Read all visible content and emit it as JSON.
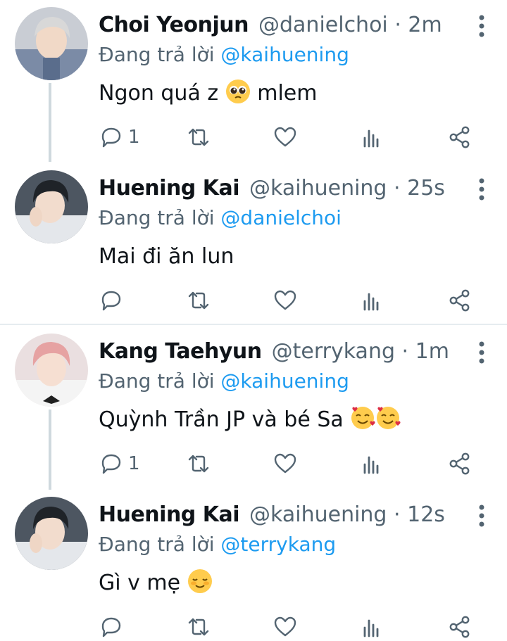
{
  "colors": {
    "text": "#0f1419",
    "secondary": "#536471",
    "link": "#1d9bf0",
    "thread": "#cfd9de"
  },
  "tweets": [
    {
      "name": "Choi Yeonjun",
      "handle": "@danielchoi",
      "separator": "·",
      "time": "2m",
      "reply_prefix": "Đang trả lời",
      "reply_to": "@kaihuening",
      "text": "Ngon quá z",
      "emoji": "pleading-face",
      "text_after": "mlem",
      "reply_count": "1",
      "avatar": "avatar-gray-hair"
    },
    {
      "name": "Huening Kai",
      "handle": "@kaihuening",
      "separator": "·",
      "time": "25s",
      "reply_prefix": "Đang trả lời",
      "reply_to": "@danielchoi",
      "text": "Mai đi ăn lun",
      "reply_count": "",
      "avatar": "avatar-dark-hair"
    },
    {
      "name": "Kang Taehyun",
      "handle": "@terrykang",
      "separator": "·",
      "time": "1m",
      "reply_prefix": "Đang trả lời",
      "reply_to": "@kaihuening",
      "text": "Quỳnh Trần JP và bé Sa",
      "emoji": "smiling-face-with-hearts",
      "reply_count": "1",
      "avatar": "avatar-pink-hair"
    },
    {
      "name": "Huening Kai",
      "handle": "@kaihuening",
      "separator": "·",
      "time": "12s",
      "reply_prefix": "Đang trả lời",
      "reply_to": "@terrykang",
      "text": "Gì v mẹ",
      "emoji": "smiling-face",
      "reply_count": "",
      "avatar": "avatar-dark-hair"
    }
  ],
  "action_icons": [
    "reply-icon",
    "retweet-icon",
    "like-icon",
    "views-icon",
    "share-icon"
  ]
}
